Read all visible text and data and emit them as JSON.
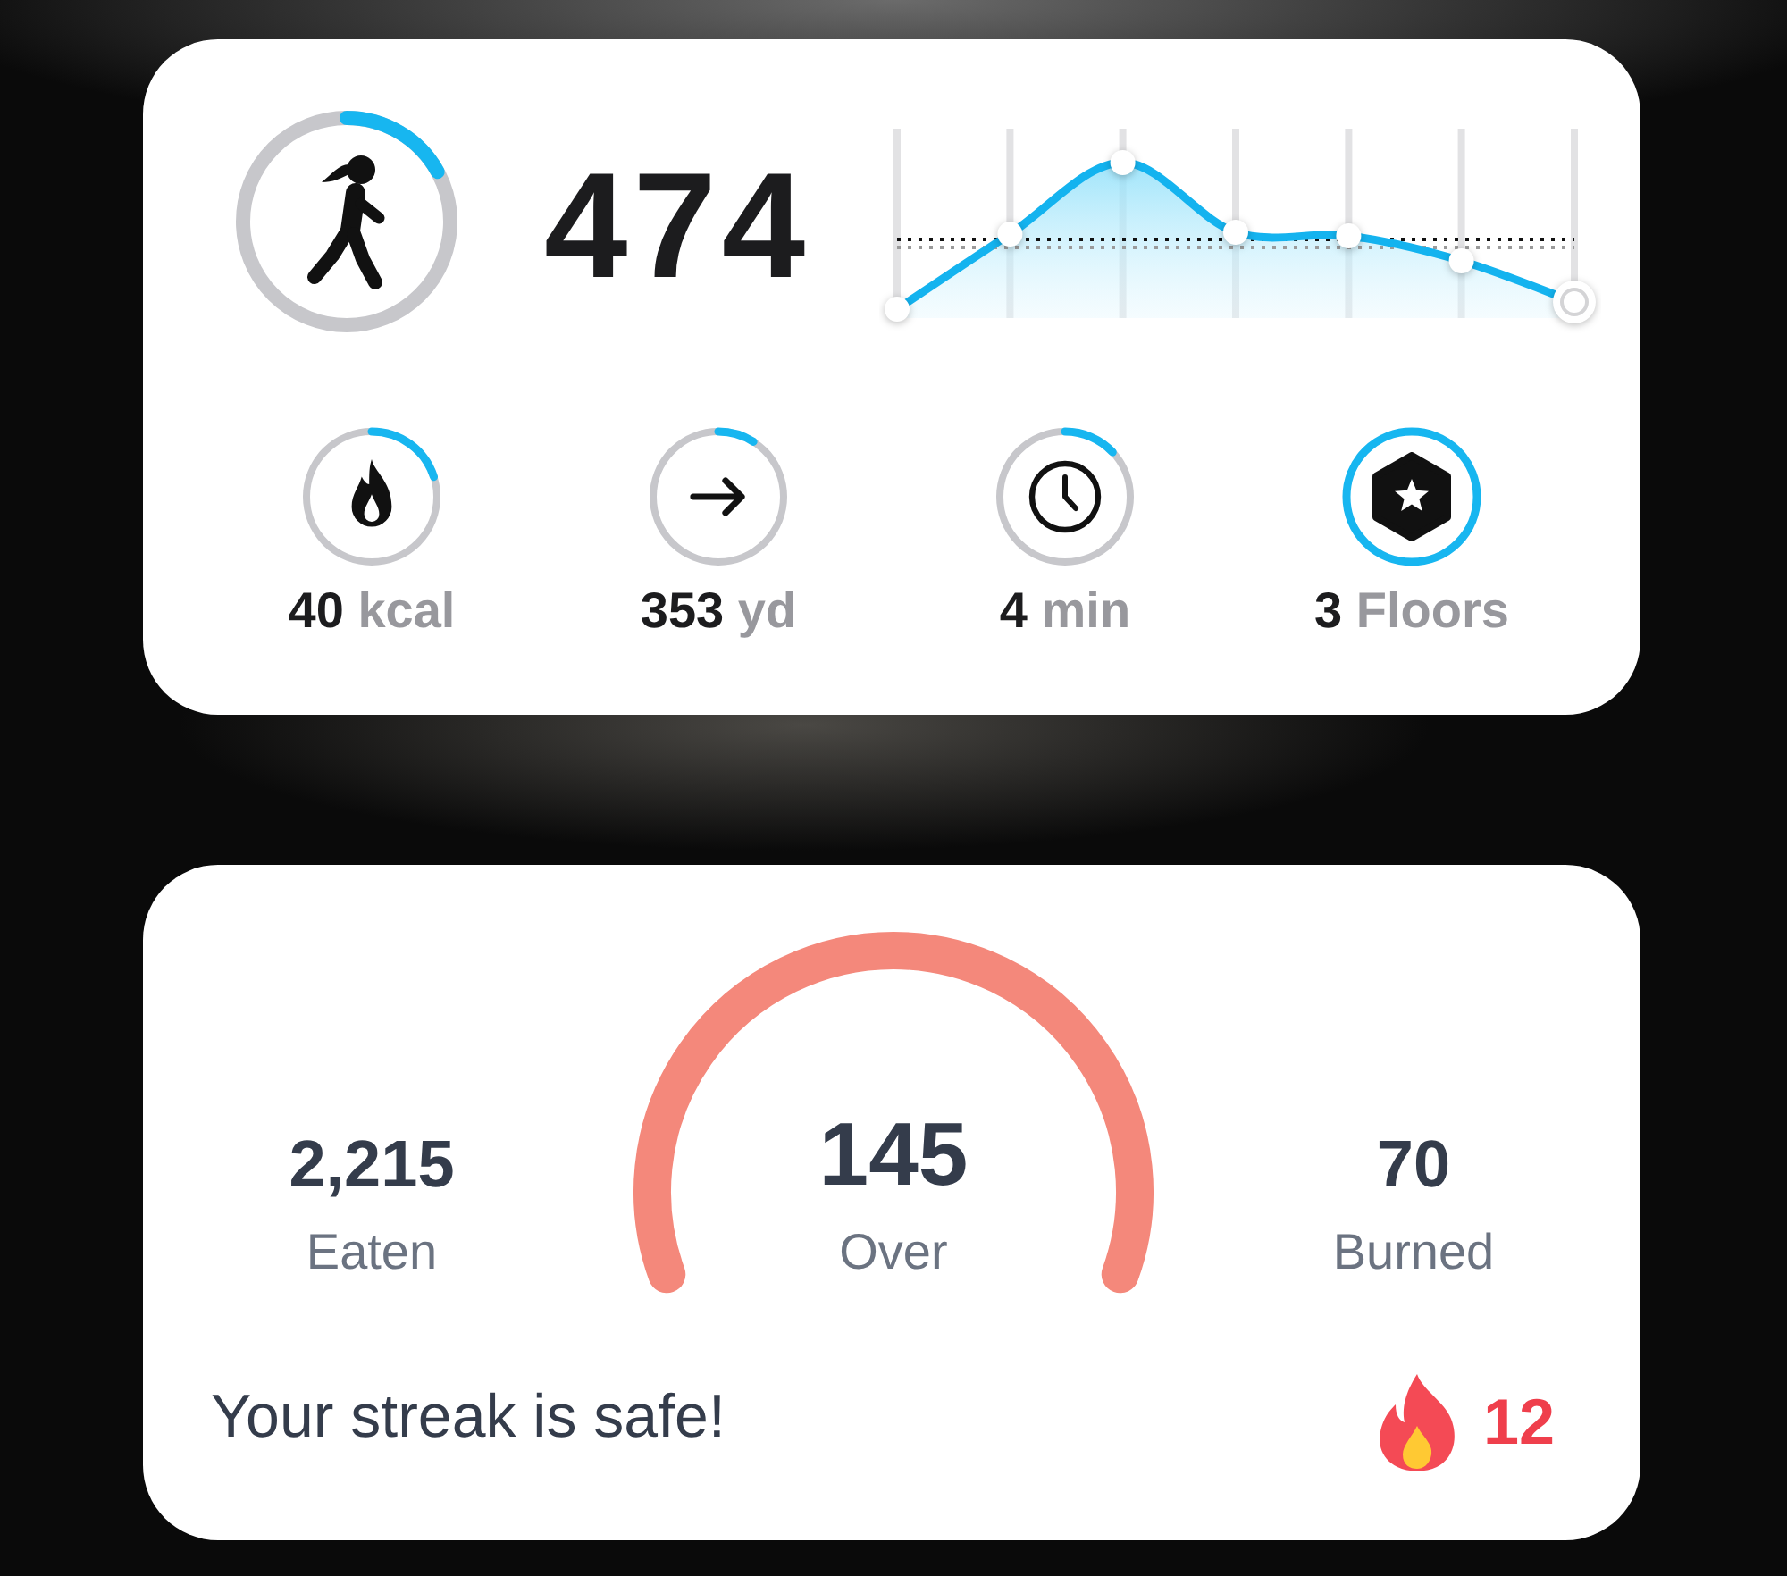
{
  "steps": {
    "count": "474",
    "level": 0.17
  },
  "stats": [
    {
      "kind": "flame",
      "value": "40",
      "unit": "kcal",
      "level": 0.2
    },
    {
      "kind": "arrow",
      "value": "353",
      "unit": "yd",
      "level": 0.09
    },
    {
      "kind": "clock",
      "value": "4",
      "unit": "min",
      "level": 0.13
    },
    {
      "kind": "badge",
      "value": "3",
      "unit": "Floors",
      "level": 1
    }
  ],
  "calories": {
    "eaten": {
      "value": "2,215",
      "label": "Eaten"
    },
    "gauge": {
      "value": "145",
      "label": "Over"
    },
    "burned": {
      "value": "70",
      "label": "Burned"
    },
    "streak": {
      "message": "Your streak is safe!",
      "count": "12"
    }
  }
}
